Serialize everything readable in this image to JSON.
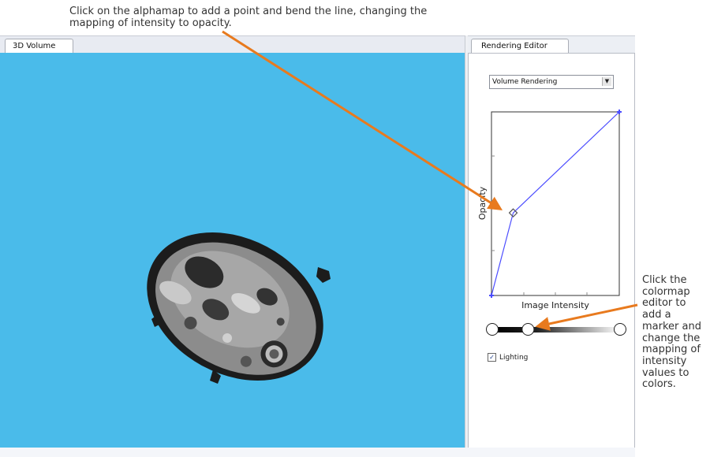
{
  "annotations": {
    "top_lines": [
      "Click on the alphamap to add a point and bend the line, changing the",
      "mapping of intensity to opacity."
    ],
    "right_lines": [
      "Click the",
      "colormap",
      "editor to",
      "add a",
      "marker and",
      "change the",
      "mapping of",
      "intensity",
      "values to",
      "colors."
    ],
    "arrow_color": "#e87a1e"
  },
  "volume_panel": {
    "tab_label": "3D Volume",
    "background_color": "#4abbea",
    "content": "ct-slice"
  },
  "editor_panel": {
    "tab_label": "Rendering Editor",
    "dropdown": {
      "selected": "Volume Rendering"
    },
    "alphamap": {
      "ylabel": "Opacity",
      "xlabel": "Image Intensity",
      "line_color": "#4b4cff",
      "points": [
        [
          0,
          0
        ],
        [
          0.17,
          0.45
        ],
        [
          1,
          1
        ]
      ],
      "selected_point": 1
    },
    "colormap": {
      "markers": [
        0,
        0.28,
        1
      ],
      "gradient": [
        "#000000",
        "#ffffff"
      ]
    },
    "lighting": {
      "label": "Lighting",
      "checked": true,
      "check_glyph": "✓"
    }
  }
}
